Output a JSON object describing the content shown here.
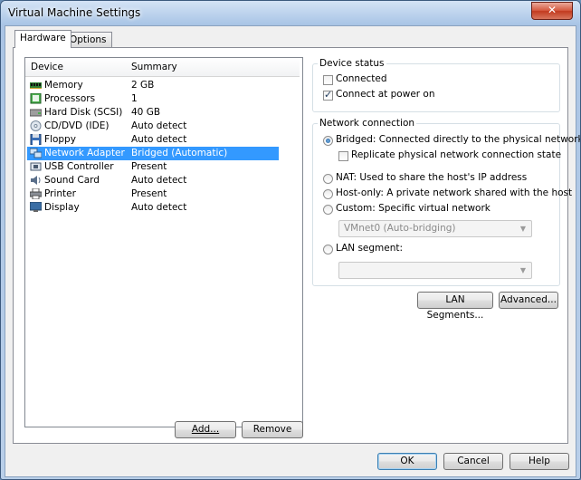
{
  "window": {
    "title": "Virtual Machine Settings",
    "close_label": "✕"
  },
  "tabs": [
    {
      "label": "Hardware"
    },
    {
      "label": "Options"
    }
  ],
  "device_list": {
    "headers": {
      "device": "Device",
      "summary": "Summary"
    },
    "rows": [
      {
        "device": "Memory",
        "summary": "2 GB",
        "icon": "memory-icon"
      },
      {
        "device": "Processors",
        "summary": "1",
        "icon": "processor-icon"
      },
      {
        "device": "Hard Disk (SCSI)",
        "summary": "40 GB",
        "icon": "hard-disk-icon"
      },
      {
        "device": "CD/DVD (IDE)",
        "summary": "Auto detect",
        "icon": "cd-dvd-icon"
      },
      {
        "device": "Floppy",
        "summary": "Auto detect",
        "icon": "floppy-icon"
      },
      {
        "device": "Network Adapter",
        "summary": "Bridged (Automatic)",
        "icon": "network-adapter-icon",
        "selected": true
      },
      {
        "device": "USB Controller",
        "summary": "Present",
        "icon": "usb-icon"
      },
      {
        "device": "Sound Card",
        "summary": "Auto detect",
        "icon": "sound-icon"
      },
      {
        "device": "Printer",
        "summary": "Present",
        "icon": "printer-icon"
      },
      {
        "device": "Display",
        "summary": "Auto detect",
        "icon": "display-icon"
      }
    ],
    "add_label": "Add...",
    "remove_label": "Remove"
  },
  "device_status": {
    "title": "Device status",
    "connected": {
      "label": "Connected",
      "checked": false
    },
    "connect_at_power_on": {
      "label": "Connect at power on",
      "checked": true
    }
  },
  "network_connection": {
    "title": "Network connection",
    "bridged": {
      "label": "Bridged: Connected directly to the physical network",
      "selected": true
    },
    "replicate": {
      "label": "Replicate physical network connection state",
      "checked": false
    },
    "nat": {
      "label": "NAT: Used to share the host's IP address"
    },
    "host_only": {
      "label": "Host-only: A private network shared with the host"
    },
    "custom": {
      "label": "Custom: Specific virtual network"
    },
    "custom_select": {
      "value": "VMnet0 (Auto-bridging)"
    },
    "lan_segment": {
      "label": "LAN segment:"
    },
    "lan_select": {
      "value": ""
    }
  },
  "buttons": {
    "lan_segments": "LAN Segments...",
    "advanced": "Advanced...",
    "ok": "OK",
    "cancel": "Cancel",
    "help": "Help"
  }
}
